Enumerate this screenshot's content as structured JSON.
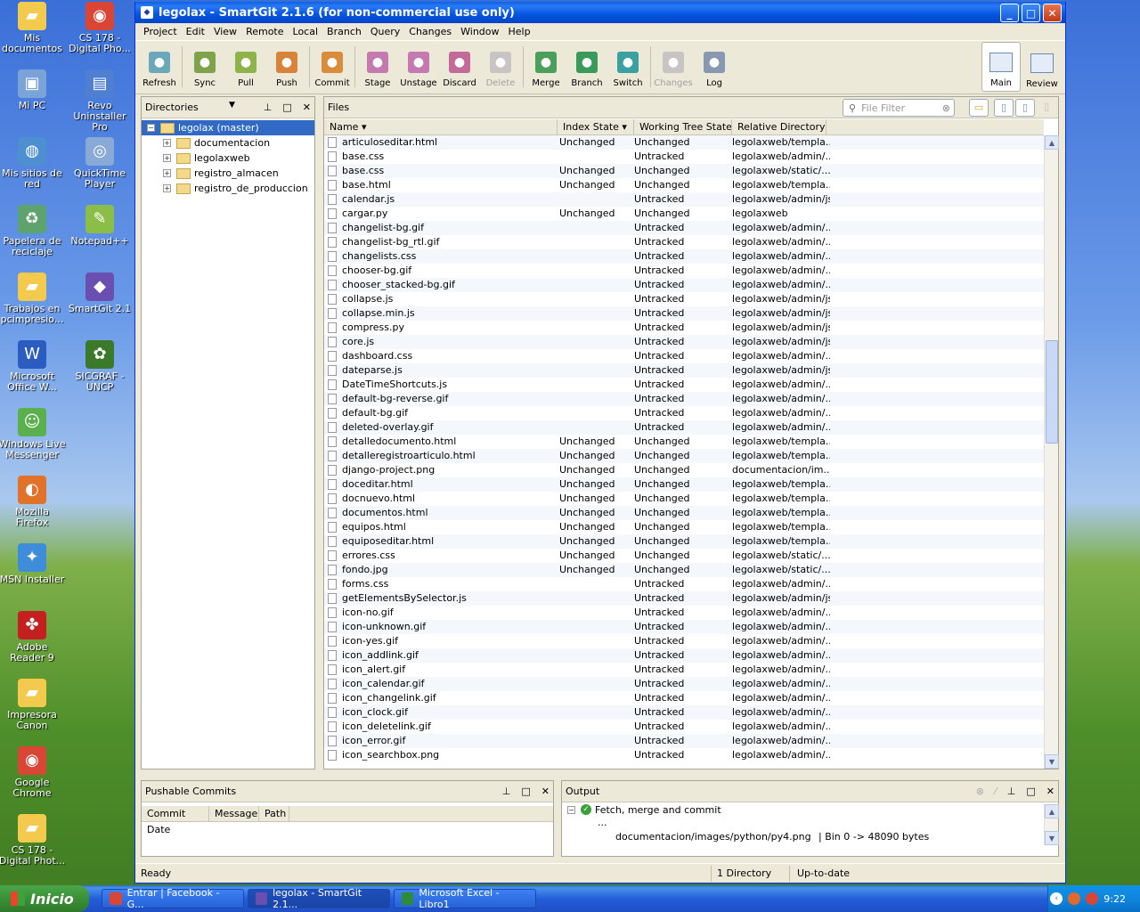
{
  "desktop": {
    "icons": [
      {
        "label": "Mis documentos",
        "icon": "folder-icon",
        "color": "#f3c94e"
      },
      {
        "label": "CS 178 - Digital Pho...",
        "icon": "chrome-icon",
        "color": "#d94636"
      },
      {
        "label": "Mi PC",
        "icon": "computer-icon",
        "color": "#7aa3d8"
      },
      {
        "label": "Revo Uninstaller Pro",
        "icon": "revo-icon",
        "color": "#4e7fd1"
      },
      {
        "label": "Mis sitios de red",
        "icon": "network-icon",
        "color": "#4d8fd1"
      },
      {
        "label": "QuickTime Player",
        "icon": "quicktime-icon",
        "color": "#89a9d6"
      },
      {
        "label": "Papelera de reciclaje",
        "icon": "recycle-bin-icon",
        "color": "#5ea36e"
      },
      {
        "label": "Notepad++",
        "icon": "notepad-icon",
        "color": "#8bbd49"
      },
      {
        "label": "Trabajos en pcimpresio...",
        "icon": "folder-icon",
        "color": "#f3c94e"
      },
      {
        "label": "SmartGit 2.1",
        "icon": "smartgit-icon",
        "color": "#6b4fb0"
      },
      {
        "label": "Microsoft Office W...",
        "icon": "word-icon",
        "color": "#2b5cbf"
      },
      {
        "label": "SICGRAF - UNCP",
        "icon": "sicgraf-icon",
        "color": "#3a7a2a"
      },
      {
        "label": "Windows Live Messenger",
        "icon": "messenger-icon",
        "color": "#5bb04e"
      },
      {
        "label": "",
        "icon": "",
        "color": ""
      },
      {
        "label": "Mozilla Firefox",
        "icon": "firefox-icon",
        "color": "#e0722a"
      },
      {
        "label": "",
        "icon": "",
        "color": ""
      },
      {
        "label": "MSN Installer",
        "icon": "msn-icon",
        "color": "#3e8ddb"
      },
      {
        "label": "",
        "icon": "",
        "color": ""
      },
      {
        "label": "Adobe Reader 9",
        "icon": "adobe-reader-icon",
        "color": "#c42020"
      },
      {
        "label": "",
        "icon": "",
        "color": ""
      },
      {
        "label": "Impresora Canon",
        "icon": "folder-icon",
        "color": "#f3c94e"
      },
      {
        "label": "",
        "icon": "",
        "color": ""
      },
      {
        "label": "Google Chrome",
        "icon": "chrome-icon",
        "color": "#d94636"
      },
      {
        "label": "",
        "icon": "",
        "color": ""
      },
      {
        "label": "CS 178 - Digital Phot...",
        "icon": "folder-icon",
        "color": "#f3c94e"
      }
    ]
  },
  "window": {
    "title": "legolax - SmartGit 2.1.6 (for non-commercial use only)",
    "minimize": "_",
    "maximize": "□",
    "close": "✕"
  },
  "menu": [
    "Project",
    "Edit",
    "View",
    "Remote",
    "Local",
    "Branch",
    "Query",
    "Changes",
    "Window",
    "Help"
  ],
  "toolbar": {
    "groups": [
      [
        {
          "label": "Refresh",
          "icon": "refresh-icon",
          "color": "#6aa7b8",
          "disabled": false
        }
      ],
      [
        {
          "label": "Sync",
          "icon": "sync-icon",
          "color": "#7fa34a",
          "disabled": false
        },
        {
          "label": "Pull",
          "icon": "pull-icon",
          "color": "#8fb34a",
          "disabled": false
        },
        {
          "label": "Push",
          "icon": "push-icon",
          "color": "#d9823a",
          "disabled": false
        }
      ],
      [
        {
          "label": "Commit",
          "icon": "commit-icon",
          "color": "#d98c3a",
          "disabled": false
        }
      ],
      [
        {
          "label": "Stage",
          "icon": "stage-icon",
          "color": "#c47ab0",
          "disabled": false
        },
        {
          "label": "Unstage",
          "icon": "unstage-icon",
          "color": "#c47ab0",
          "disabled": false
        },
        {
          "label": "Discard",
          "icon": "discard-icon",
          "color": "#c46a9a",
          "disabled": false
        },
        {
          "label": "Delete",
          "icon": "delete-icon",
          "color": "#c8c4c4",
          "disabled": true
        }
      ],
      [
        {
          "label": "Merge",
          "icon": "merge-icon",
          "color": "#4aa05a",
          "disabled": false
        },
        {
          "label": "Branch",
          "icon": "branch-icon",
          "color": "#3a9a5a",
          "disabled": false
        },
        {
          "label": "Switch",
          "icon": "switch-icon",
          "color": "#3aa0a0",
          "disabled": false
        }
      ],
      [
        {
          "label": "Changes",
          "icon": "changes-icon",
          "color": "#c8c4c4",
          "disabled": true
        },
        {
          "label": "Log",
          "icon": "log-icon",
          "color": "#8898b0",
          "disabled": false
        }
      ]
    ],
    "perspectives": [
      {
        "label": "Main",
        "selected": true
      },
      {
        "label": "Review",
        "selected": false
      }
    ]
  },
  "directories": {
    "title": "Directories",
    "tree": [
      {
        "label": "legolax (master)",
        "level": 0,
        "expander": "−",
        "selected": true
      },
      {
        "label": "documentacion",
        "level": 1,
        "expander": "+",
        "selected": false
      },
      {
        "label": "legolaxweb",
        "level": 1,
        "expander": "+",
        "selected": false
      },
      {
        "label": "registro_almacen",
        "level": 1,
        "expander": "+",
        "selected": false
      },
      {
        "label": "registro_de_produccion",
        "level": 1,
        "expander": "+",
        "selected": false
      }
    ]
  },
  "files": {
    "title": "Files",
    "filter_placeholder": "File Filter",
    "columns": [
      "Name ▾",
      "Index State ▾",
      "Working Tree State ▾",
      "Relative Directory"
    ],
    "rows": [
      [
        "articuloseditar.html",
        "Unchanged",
        "Unchanged",
        "legolaxweb/templa..."
      ],
      [
        "base.css",
        "",
        "Untracked",
        "legolaxweb/admin/..."
      ],
      [
        "base.css",
        "Unchanged",
        "Unchanged",
        "legolaxweb/static/..."
      ],
      [
        "base.html",
        "Unchanged",
        "Unchanged",
        "legolaxweb/templa..."
      ],
      [
        "calendar.js",
        "",
        "Untracked",
        "legolaxweb/admin/js"
      ],
      [
        "cargar.py",
        "Unchanged",
        "Unchanged",
        "legolaxweb"
      ],
      [
        "changelist-bg.gif",
        "",
        "Untracked",
        "legolaxweb/admin/..."
      ],
      [
        "changelist-bg_rtl.gif",
        "",
        "Untracked",
        "legolaxweb/admin/..."
      ],
      [
        "changelists.css",
        "",
        "Untracked",
        "legolaxweb/admin/..."
      ],
      [
        "chooser-bg.gif",
        "",
        "Untracked",
        "legolaxweb/admin/..."
      ],
      [
        "chooser_stacked-bg.gif",
        "",
        "Untracked",
        "legolaxweb/admin/..."
      ],
      [
        "collapse.js",
        "",
        "Untracked",
        "legolaxweb/admin/js"
      ],
      [
        "collapse.min.js",
        "",
        "Untracked",
        "legolaxweb/admin/js"
      ],
      [
        "compress.py",
        "",
        "Untracked",
        "legolaxweb/admin/js"
      ],
      [
        "core.js",
        "",
        "Untracked",
        "legolaxweb/admin/js"
      ],
      [
        "dashboard.css",
        "",
        "Untracked",
        "legolaxweb/admin/..."
      ],
      [
        "dateparse.js",
        "",
        "Untracked",
        "legolaxweb/admin/js"
      ],
      [
        "DateTimeShortcuts.js",
        "",
        "Untracked",
        "legolaxweb/admin/..."
      ],
      [
        "default-bg-reverse.gif",
        "",
        "Untracked",
        "legolaxweb/admin/..."
      ],
      [
        "default-bg.gif",
        "",
        "Untracked",
        "legolaxweb/admin/..."
      ],
      [
        "deleted-overlay.gif",
        "",
        "Untracked",
        "legolaxweb/admin/..."
      ],
      [
        "detalledocumento.html",
        "Unchanged",
        "Unchanged",
        "legolaxweb/templa..."
      ],
      [
        "detalleregistroarticulo.html",
        "Unchanged",
        "Unchanged",
        "legolaxweb/templa..."
      ],
      [
        "django-project.png",
        "Unchanged",
        "Unchanged",
        "documentacion/im..."
      ],
      [
        "doceditar.html",
        "Unchanged",
        "Unchanged",
        "legolaxweb/templa..."
      ],
      [
        "docnuevo.html",
        "Unchanged",
        "Unchanged",
        "legolaxweb/templa..."
      ],
      [
        "documentos.html",
        "Unchanged",
        "Unchanged",
        "legolaxweb/templa..."
      ],
      [
        "equipos.html",
        "Unchanged",
        "Unchanged",
        "legolaxweb/templa..."
      ],
      [
        "equiposeditar.html",
        "Unchanged",
        "Unchanged",
        "legolaxweb/templa..."
      ],
      [
        "errores.css",
        "Unchanged",
        "Unchanged",
        "legolaxweb/static/..."
      ],
      [
        "fondo.jpg",
        "Unchanged",
        "Unchanged",
        "legolaxweb/static/..."
      ],
      [
        "forms.css",
        "",
        "Untracked",
        "legolaxweb/admin/..."
      ],
      [
        "getElementsBySelector.js",
        "",
        "Untracked",
        "legolaxweb/admin/js"
      ],
      [
        "icon-no.gif",
        "",
        "Untracked",
        "legolaxweb/admin/..."
      ],
      [
        "icon-unknown.gif",
        "",
        "Untracked",
        "legolaxweb/admin/..."
      ],
      [
        "icon-yes.gif",
        "",
        "Untracked",
        "legolaxweb/admin/..."
      ],
      [
        "icon_addlink.gif",
        "",
        "Untracked",
        "legolaxweb/admin/..."
      ],
      [
        "icon_alert.gif",
        "",
        "Untracked",
        "legolaxweb/admin/..."
      ],
      [
        "icon_calendar.gif",
        "",
        "Untracked",
        "legolaxweb/admin/..."
      ],
      [
        "icon_changelink.gif",
        "",
        "Untracked",
        "legolaxweb/admin/..."
      ],
      [
        "icon_clock.gif",
        "",
        "Untracked",
        "legolaxweb/admin/..."
      ],
      [
        "icon_deletelink.gif",
        "",
        "Untracked",
        "legolaxweb/admin/..."
      ],
      [
        "icon_error.gif",
        "",
        "Untracked",
        "legolaxweb/admin/..."
      ],
      [
        "icon_searchbox.png",
        "",
        "Untracked",
        "legolaxweb/admin/..."
      ]
    ]
  },
  "pushable": {
    "title": "Pushable Commits",
    "columns": [
      "Commit Date",
      "Message",
      "Path"
    ]
  },
  "output": {
    "title": "Output",
    "lines": [
      {
        "text": "Fetch, merge and commit",
        "kind": "header"
      },
      {
        "text": "...",
        "kind": "ellipsis"
      },
      {
        "text": "documentacion/images/python/py4.png",
        "extra": "| Bin 0 -> 48090 bytes",
        "kind": "entry"
      }
    ]
  },
  "status": {
    "text": "Ready",
    "directories": "1 Directory",
    "state": "Up-to-date"
  },
  "taskbar": {
    "start": "Inicio",
    "tasks": [
      {
        "label": "Entrar | Facebook - G...",
        "icon": "chrome-icon",
        "color": "#d94636",
        "active": false
      },
      {
        "label": "legolax - SmartGit 2.1...",
        "icon": "smartgit-icon",
        "color": "#6b4fb0",
        "active": true
      },
      {
        "label": "Microsoft Excel - Libro1",
        "icon": "excel-icon",
        "color": "#2f8a3a",
        "active": false
      }
    ],
    "clock": "9:22"
  }
}
